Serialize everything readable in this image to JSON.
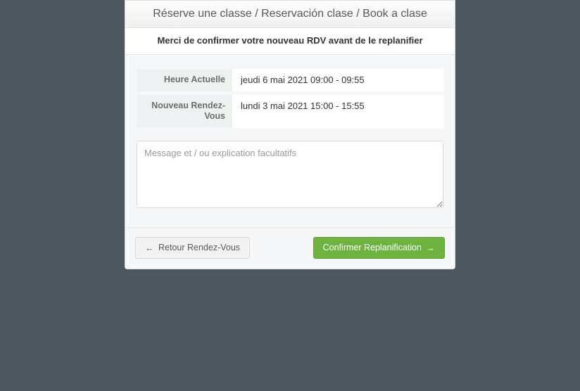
{
  "header": {
    "title": "Réserve une classe / Reservación clase / Book a clase"
  },
  "subheader": {
    "confirm_text": "Merci de confirmer votre nouveau RDV avant de le replanifier"
  },
  "fields": {
    "current_time": {
      "label": "Heure Actuelle",
      "value": "jeudi 6 mai 2021 09:00 - 09:55"
    },
    "new_appointment": {
      "label": "Nouveau Rendez-Vous",
      "value": "lundi 3 mai 2021 15:00 - 15:55"
    }
  },
  "message": {
    "placeholder": "Message et / ou explication facultatifs",
    "value": ""
  },
  "buttons": {
    "back_arrow": "←",
    "back_label": "Retour Rendez-Vous",
    "confirm_label": "Confirmer Replanification",
    "confirm_arrow": "→"
  }
}
